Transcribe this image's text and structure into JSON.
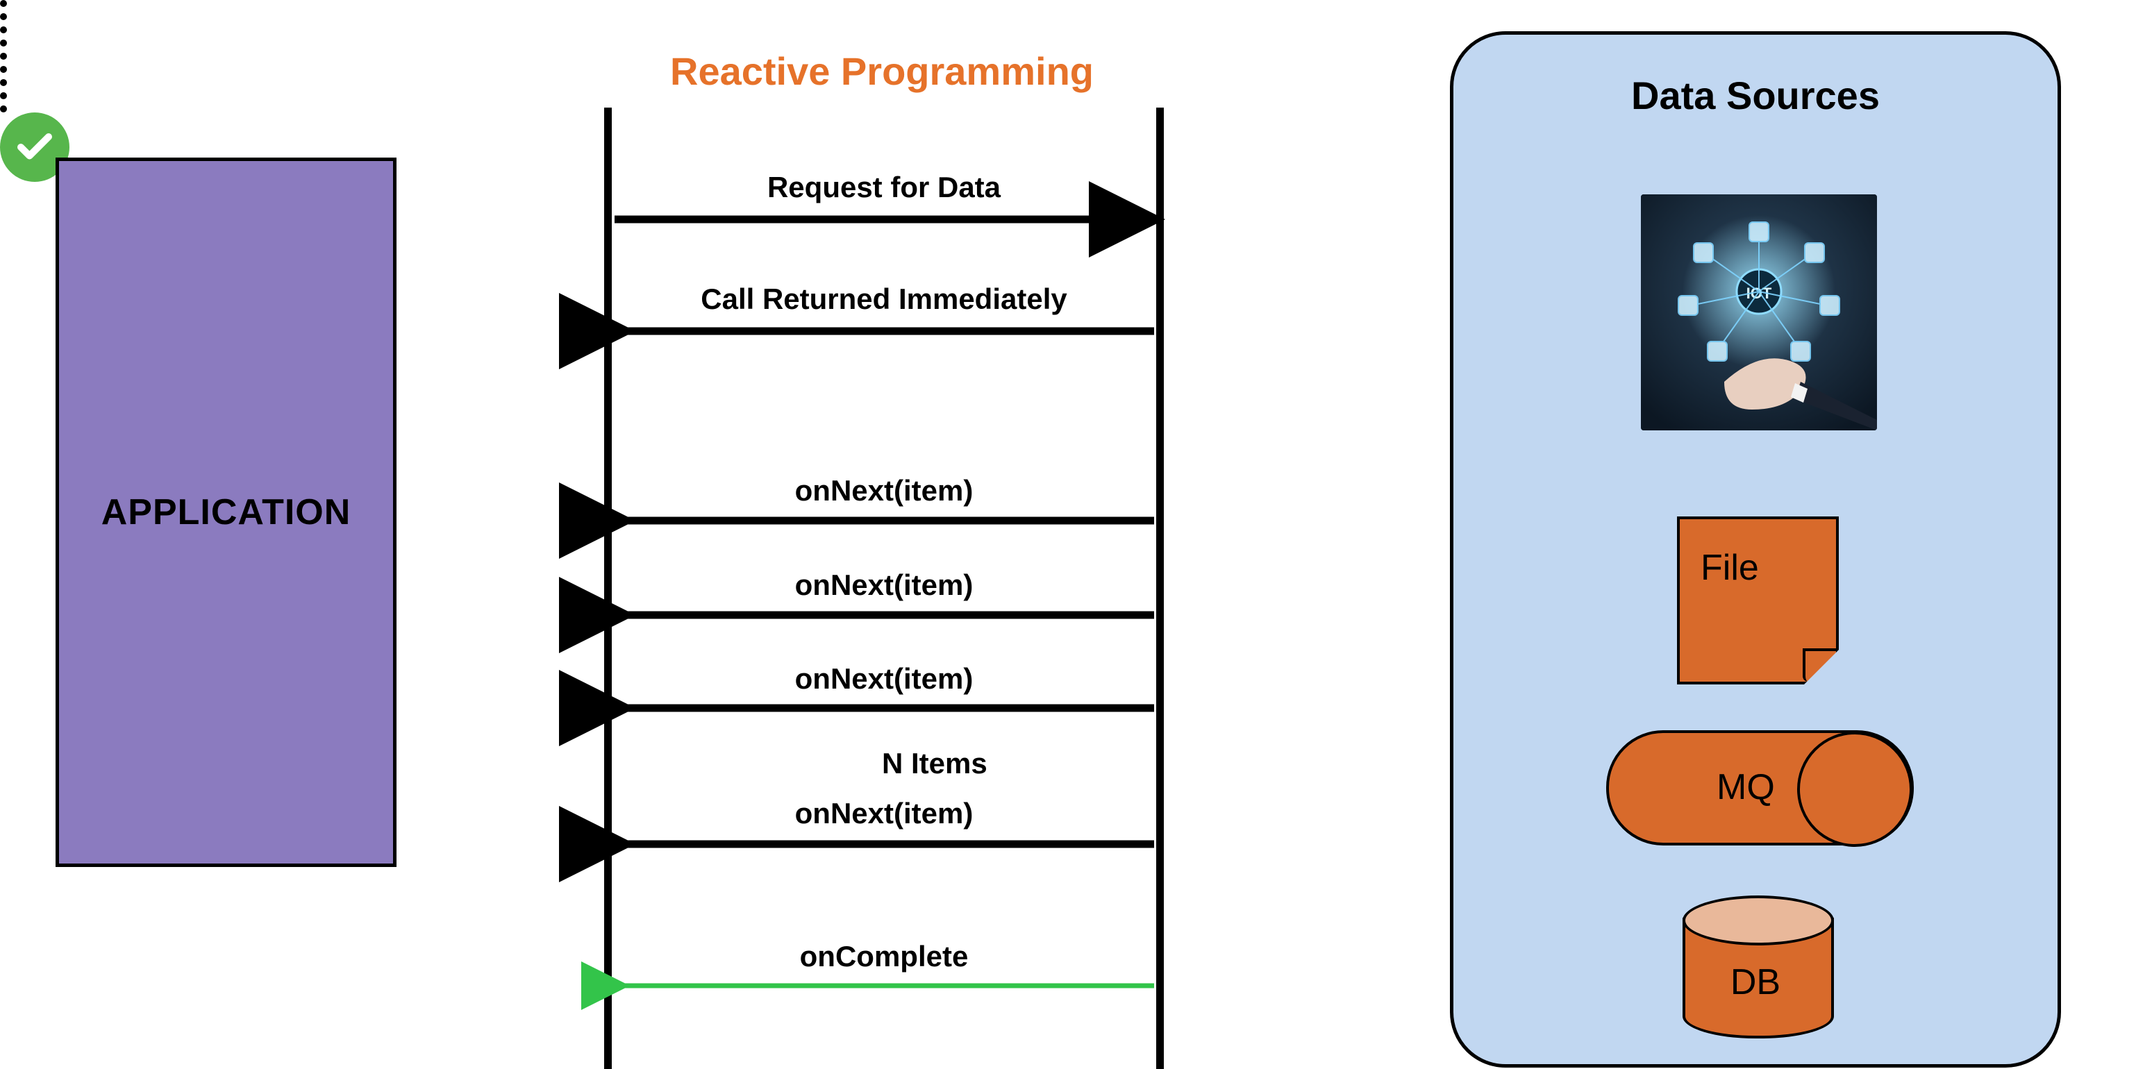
{
  "application_label": "APPLICATION",
  "title": "Reactive Programming",
  "arrows": {
    "request": "Request for Data",
    "returned": "Call Returned Immediately",
    "onNext1": "onNext(item)",
    "onNext2": "onNext(item)",
    "onNext3": "onNext(item)",
    "nItems": "N Items",
    "onNext4": "onNext(item)",
    "onComplete": "onComplete"
  },
  "data_sources": {
    "title": "Data Sources",
    "iot_label": "IOT",
    "file": "File",
    "mq": "MQ",
    "db": "DB"
  },
  "colors": {
    "accent_orange": "#d86a2b",
    "title_orange": "#e6722a",
    "app_purple": "#8b7bbf",
    "panel_blue": "#c1d7f1",
    "complete_green": "#57b64c",
    "arrow_green": "#33c44a"
  }
}
